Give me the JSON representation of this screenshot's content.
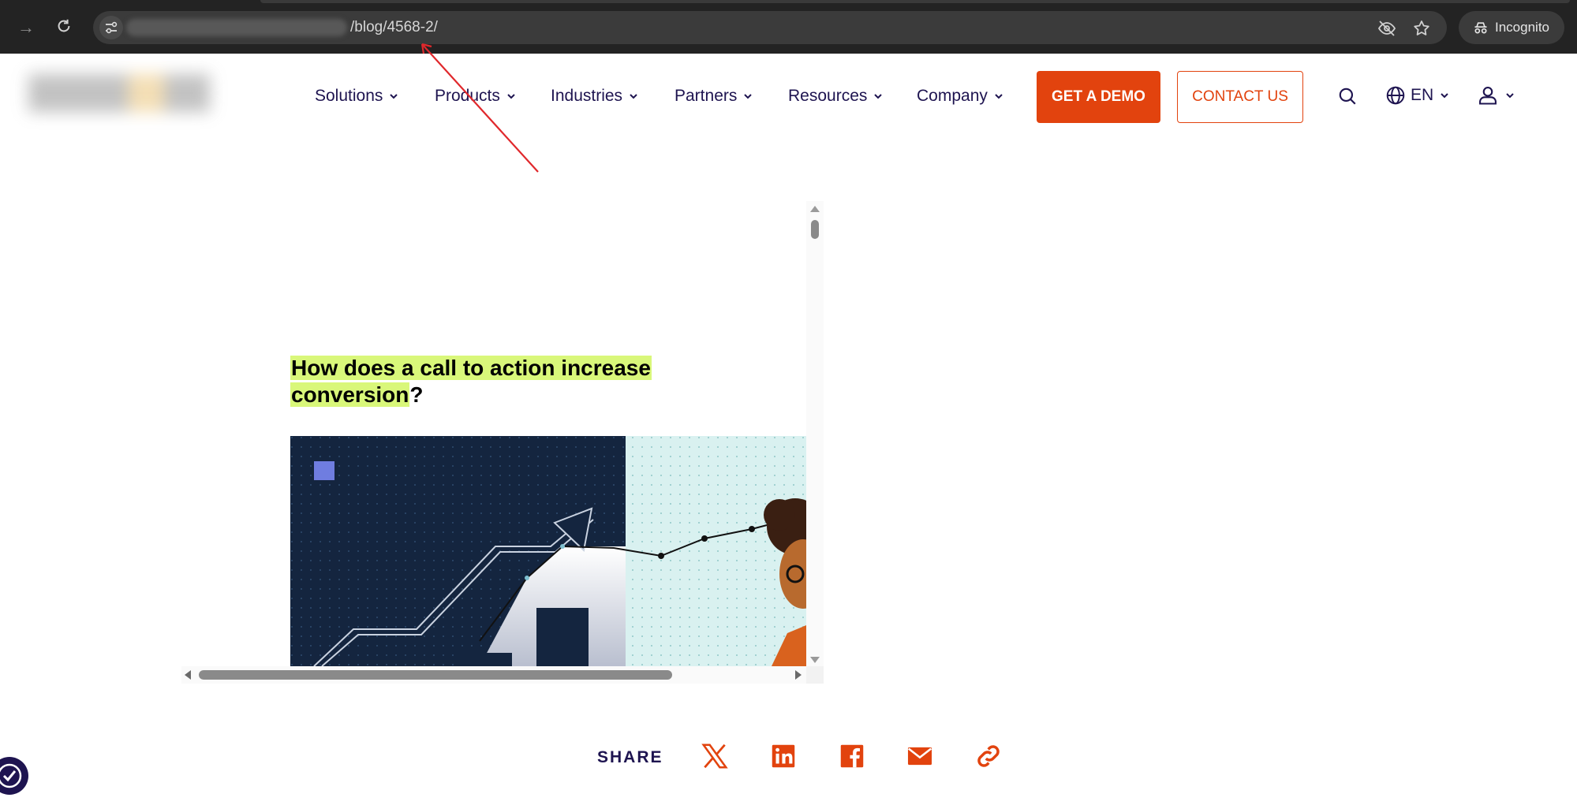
{
  "browser": {
    "url_path": "/blog/4568-2/",
    "incognito_label": "Incognito",
    "icons": [
      "forward-icon",
      "reload-icon",
      "site-info-icon",
      "eye-off-icon",
      "star-icon",
      "incognito-icon"
    ]
  },
  "header": {
    "nav": [
      {
        "label": "Solutions"
      },
      {
        "label": "Products"
      },
      {
        "label": "Industries"
      },
      {
        "label": "Partners"
      },
      {
        "label": "Resources"
      },
      {
        "label": "Company"
      }
    ],
    "demo_button": "GET A DEMO",
    "contact_button": "CONTACT US",
    "language": "EN",
    "colors": {
      "brand_orange": "#e2430e",
      "navy": "#1e1450"
    }
  },
  "article": {
    "title_highlight_1": "How does a call to action increase",
    "title_highlight_2": "conversion",
    "title_tail": "?",
    "highlight_color": "#d9f77a"
  },
  "share": {
    "label": "SHARE",
    "icons": [
      "x-icon",
      "linkedin-icon",
      "facebook-icon",
      "email-icon",
      "link-icon"
    ]
  }
}
